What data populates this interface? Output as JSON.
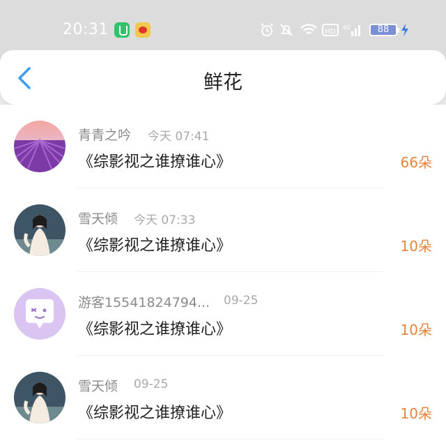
{
  "status_bar": {
    "time": "20:31",
    "battery": "88",
    "icons": [
      "green-app-icon",
      "weibo-icon",
      "alarm-icon",
      "mute-icon",
      "wifi-icon",
      "hd-icon",
      "4g-signal-icon",
      "battery-icon",
      "charging-icon"
    ]
  },
  "header": {
    "title": "鲜花",
    "back_icon": "chevron-left-icon",
    "accent_color": "#3b9cf0"
  },
  "gifts": [
    {
      "name": "青青之吟",
      "time": "今天 07:41",
      "title": "《综影视之谁撩谁心》",
      "count": "66朵",
      "avatar": "lavender-field-avatar"
    },
    {
      "name": "雪天倾",
      "time": "今天 07:33",
      "title": "《综影视之谁撩谁心》",
      "count": "10朵",
      "avatar": "costume-girl-avatar"
    },
    {
      "name": "游客15541824794...",
      "time": "09-25",
      "title": "《综影视之谁撩谁心》",
      "count": "10朵",
      "avatar": "guest-chat-avatar"
    },
    {
      "name": "雪天倾",
      "time": "09-25",
      "title": "《综影视之谁撩谁心》",
      "count": "10朵",
      "avatar": "costume-girl-avatar"
    }
  ],
  "colors": {
    "count": "#e8833a",
    "name": "#8a8a8a",
    "time": "#a8a8a8",
    "guest_avatar_bg": "#d9c4f2"
  }
}
